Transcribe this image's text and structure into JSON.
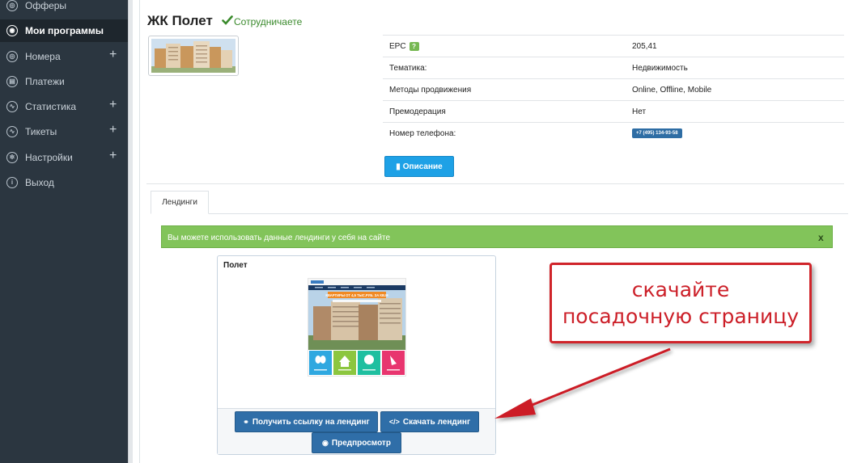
{
  "sidebar": {
    "items": [
      {
        "label": "Офферы",
        "has_plus": false,
        "icon": "offers-icon",
        "glyph": "◎"
      },
      {
        "label": "Мои программы",
        "has_plus": false,
        "icon": "programs-icon",
        "glyph": "◉",
        "active": true
      },
      {
        "label": "Номера",
        "has_plus": true,
        "icon": "numbers-icon",
        "glyph": "◎"
      },
      {
        "label": "Платежи",
        "has_plus": false,
        "icon": "payments-icon",
        "glyph": "▤"
      },
      {
        "label": "Статистика",
        "has_plus": true,
        "icon": "statistics-icon",
        "glyph": "∿"
      },
      {
        "label": "Тикеты",
        "has_plus": true,
        "icon": "tickets-icon",
        "glyph": "∿"
      },
      {
        "label": "Настройки",
        "has_plus": true,
        "icon": "settings-icon",
        "glyph": "✲"
      },
      {
        "label": "Выход",
        "has_plus": false,
        "icon": "logout-icon",
        "glyph": "i"
      }
    ],
    "plus_glyph": "+"
  },
  "program": {
    "title": "ЖК Полет",
    "status": "Сотрудничаете",
    "info": {
      "epc": {
        "label": "EPC",
        "help": "?",
        "value": "205,41"
      },
      "topic": {
        "label": "Тематика:",
        "value": "Недвижимость"
      },
      "methods": {
        "label": "Методы продвижения",
        "value": "Online, Offline, Mobile"
      },
      "premod": {
        "label": "Премодерация",
        "value": "Нет"
      },
      "phone": {
        "label": "Номер телефона:",
        "value": "+7 (495) 134-93-58"
      }
    },
    "description_button": "Описание"
  },
  "tabs": {
    "landings": "Лендинги"
  },
  "alert": {
    "text": "Вы можете использовать данные лендинги у себя на сайте",
    "close": "x"
  },
  "landing_card": {
    "title": "Полет",
    "get_link_button": "Получить ссылку на лендинг",
    "download_button": "Скачать лендинг",
    "preview_button": "Предпросмотр",
    "preview": {
      "banner_text": "КВАРТИРЫ ОТ 4,5 ТЫС.РУБ. ЗА КВ.М",
      "tile_colors": [
        "#2fa8e0",
        "#8cc63f",
        "#1fbfa0",
        "#e8356f"
      ]
    }
  },
  "callout": {
    "line1": "скачайте",
    "line2": "посадочную страницу"
  },
  "colors": {
    "sidebar_bg": "#2b3640",
    "primary_button": "#2f6ea8",
    "info_button": "#1ea1e6",
    "alert_bg": "#82c45a",
    "callout_red": "#d0242a",
    "status_green": "#3a8a2c"
  }
}
